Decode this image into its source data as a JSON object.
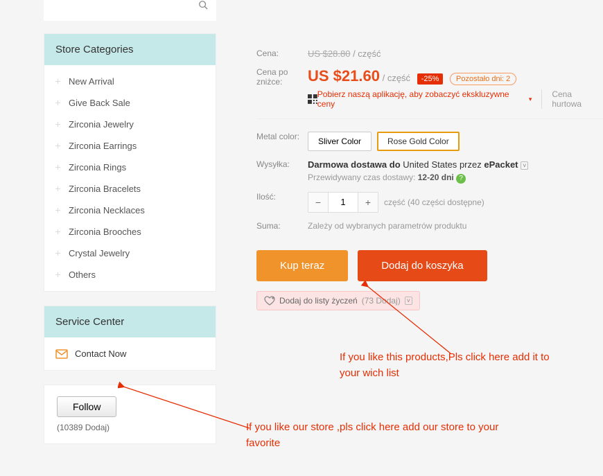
{
  "sidebar": {
    "categories_header": "Store Categories",
    "items": [
      "New Arrival",
      "Give Back Sale",
      "Zirconia Jewelry",
      "Zirconia Earrings",
      "Zirconia Rings",
      "Zirconia Bracelets",
      "Zirconia Necklaces",
      "Zirconia Brooches",
      "Crystal Jewelry",
      "Others"
    ],
    "service_header": "Service Center",
    "contact": "Contact Now",
    "follow_label": "Follow",
    "follow_count": "(10389 Dodaj)"
  },
  "product": {
    "price_label": "Cena:",
    "old_price": "US $28.80",
    "old_unit": "/ część",
    "discount_label": "Cena po zniżce:",
    "price": "US $21.60",
    "price_unit": "/ część",
    "discount_badge": "-25%",
    "time_left": "Pozostało dni: 2",
    "app_promo": "Pobierz naszą aplikację, aby zobaczyć ekskluzywne ceny",
    "wholesale": "Cena hurtowa",
    "variant_label": "Metal color:",
    "variants": [
      "Sliver Color",
      "Rose Gold Color"
    ],
    "shipping_label": "Wysyłka:",
    "shipping_free": "Darmowa dostawa do",
    "shipping_country": "United States",
    "shipping_via": "przez",
    "shipping_method": "ePacket",
    "shipping_est": "Przewidywany czas dostawy:",
    "shipping_days": "12-20 dni",
    "qty_label": "Ilość:",
    "qty_value": "1",
    "qty_unit": "część",
    "qty_available": "(40 części dostępne)",
    "total_label": "Suma:",
    "total_depends": "Zależy od wybranych parametrów produktu",
    "buy_now": "Kup teraz",
    "add_cart": "Dodaj do koszyka",
    "wishlist": "Dodaj do listy życzeń",
    "wishlist_count": "(73 Dodaj)"
  },
  "annotations": {
    "wishlist_note": "If you like this products,Pls click here add it to your wich list",
    "follow_note": "If you like our store ,pls click here add our store to your favorite"
  }
}
